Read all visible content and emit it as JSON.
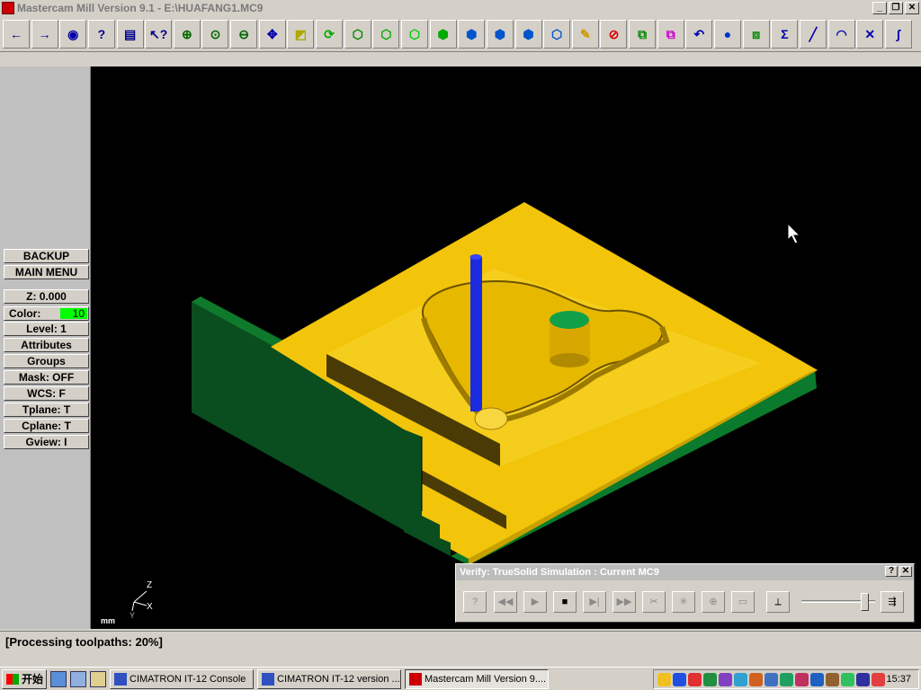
{
  "window": {
    "title": "Mastercam Mill Version 9.1 - E:\\HUAFANG1.MC9",
    "controls": [
      "_",
      "❐",
      "✕"
    ]
  },
  "toolbar": {
    "icons": [
      "back-arrow-icon",
      "forward-arrow-icon",
      "mcu-icon",
      "help-icon",
      "calculator-icon",
      "whats-this-icon",
      "zoom-window-icon",
      "zoom-fit-icon",
      "zoom-out-icon",
      "pan-icon",
      "analyze-icon",
      "rotate-icon",
      "top-view-icon",
      "front-view-icon",
      "side-view-icon",
      "iso-view-icon",
      "cplane-top-icon",
      "cplane-front-icon",
      "cplane-side-icon",
      "cplane-3d-icon",
      "eraser-icon",
      "no-shading-icon",
      "transform-icon",
      "translate-icon",
      "undo-icon",
      "shade-sphere-icon",
      "layers-icon",
      "sum-icon",
      "line-icon",
      "arc-icon",
      "trim-icon",
      "spline-icon"
    ]
  },
  "sidebar": {
    "backup": "BACKUP",
    "main_menu": "MAIN MENU",
    "z": "Z:   0.000",
    "color_label": "Color:",
    "color_value": "10",
    "level": "Level:   1",
    "attributes": "Attributes",
    "groups": "Groups",
    "mask": "Mask:   OFF",
    "wcs": "WCS:   F",
    "tplane": "Tplane:   T",
    "cplane": "Cplane:   T",
    "gview": "Gview:   I"
  },
  "viewport": {
    "units": "mm",
    "axis_z": "Z",
    "axis_x": "X",
    "axis_y": "Y"
  },
  "verify": {
    "title": "Verify: TrueSolid Simulation : Current MC9",
    "help": "?",
    "close": "✕",
    "controls": [
      "?",
      "◀◀",
      "▶",
      "■",
      "▶|",
      "▶▶",
      "✂",
      "✳",
      "⊕",
      "▭",
      "⟂",
      "⇶"
    ]
  },
  "status": {
    "text": "[Processing toolpaths:   20%]"
  },
  "taskbar": {
    "start": "开始",
    "tasks": [
      "CIMATRON IT-12 Console",
      "CIMATRON IT-12 version ...",
      "Mastercam Mill Version 9...."
    ],
    "clock": "15:37",
    "tray_colors": [
      "#f0c020",
      "#2050e0",
      "#e03030",
      "#209040",
      "#8040c0",
      "#30a0d0",
      "#d06020",
      "#4070c0",
      "#20a060",
      "#c03060",
      "#2060c0",
      "#906030",
      "#30c060",
      "#c0c020",
      "#3030a0",
      "#e04040"
    ]
  },
  "colors": {
    "part": "#f2c40a",
    "base": "#0b6b2a",
    "tool": "#1a2be0",
    "tool_holder": "#11a04a"
  }
}
